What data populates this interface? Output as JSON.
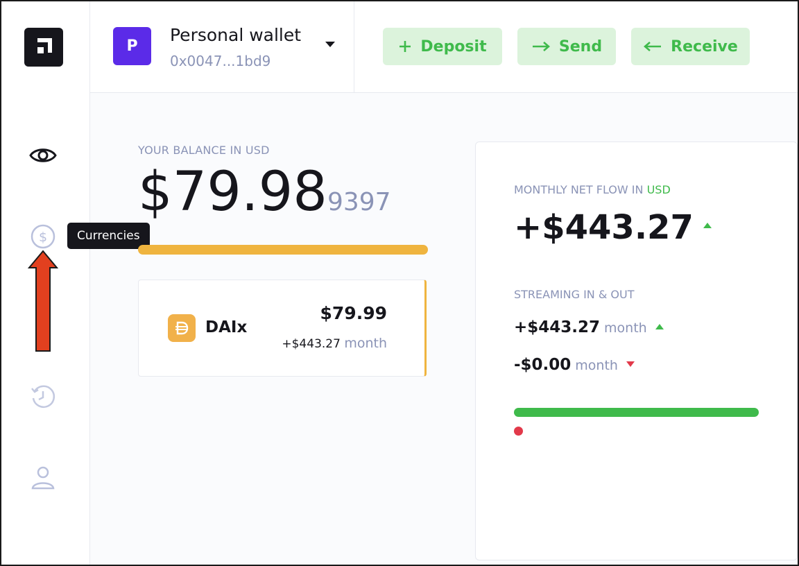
{
  "sidebar": {
    "logo": "app-logo",
    "items": [
      {
        "name": "eye-icon"
      },
      {
        "name": "currency-icon"
      },
      {
        "name": "history-icon"
      },
      {
        "name": "profile-icon"
      }
    ],
    "tooltip": "Currencies"
  },
  "header": {
    "wallet": {
      "avatar_letter": "P",
      "name": "Personal wallet",
      "address": "0x0047...1bd9"
    },
    "actions": {
      "deposit": "Deposit",
      "send": "Send",
      "receive": "Receive"
    }
  },
  "balance": {
    "label": "YOUR BALANCE IN USD",
    "amount_main": "$79.98",
    "amount_decimals": "9397"
  },
  "token": {
    "symbol": "DAIx",
    "amount": "$79.99",
    "flow": "+$443.27",
    "flow_unit": "month"
  },
  "flow_panel": {
    "label_prefix": "MONTHLY NET FLOW IN",
    "label_currency": "USD",
    "net_amount": "+$443.27",
    "stream_label": "STREAMING IN & OUT",
    "in_amount": "+$443.27",
    "in_unit": "month",
    "out_amount": "-$0.00",
    "out_unit": "month"
  },
  "colors": {
    "accent_green": "#3fba4b",
    "button_bg": "#dcf3dc",
    "token_orange": "#efb43f",
    "negative_red": "#e2394a",
    "wallet_purple": "#5b2be8"
  }
}
